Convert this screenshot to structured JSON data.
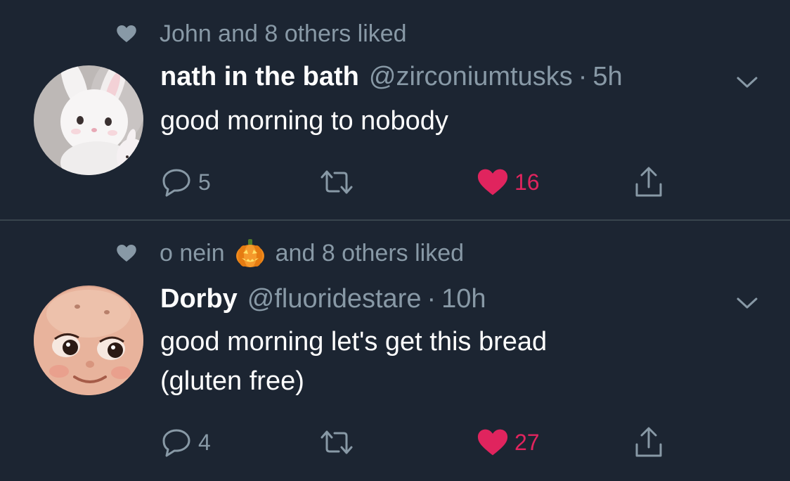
{
  "colors": {
    "background": "#1c2532",
    "secondary_text": "#8899a6",
    "primary_text": "#ffffff",
    "like": "#e0245e",
    "divider": "#38444d"
  },
  "tweets": [
    {
      "social_context": "John and 8 others liked",
      "social_context_icon": "heart-icon",
      "avatar": "white-bunny-plush-avatar",
      "display_name": "nath in the bath",
      "handle": "@zirconiumtusks",
      "separator": "·",
      "timestamp": "5h",
      "text_lines": [
        "good morning to nobody"
      ],
      "replies": "5",
      "likes": "16",
      "liked": true
    },
    {
      "social_context_name": "o nein",
      "social_context_emoji": "jack-o-lantern",
      "social_context_rest": "and 8 others liked",
      "social_context_icon": "heart-icon",
      "avatar": "kewpie-face-avatar",
      "display_name": "Dorby",
      "handle": "@fluoridestare",
      "separator": "·",
      "timestamp": "10h",
      "text_lines": [
        "good morning let's get this bread",
        "(gluten free)"
      ],
      "replies": "4",
      "likes": "27",
      "liked": true
    }
  ]
}
